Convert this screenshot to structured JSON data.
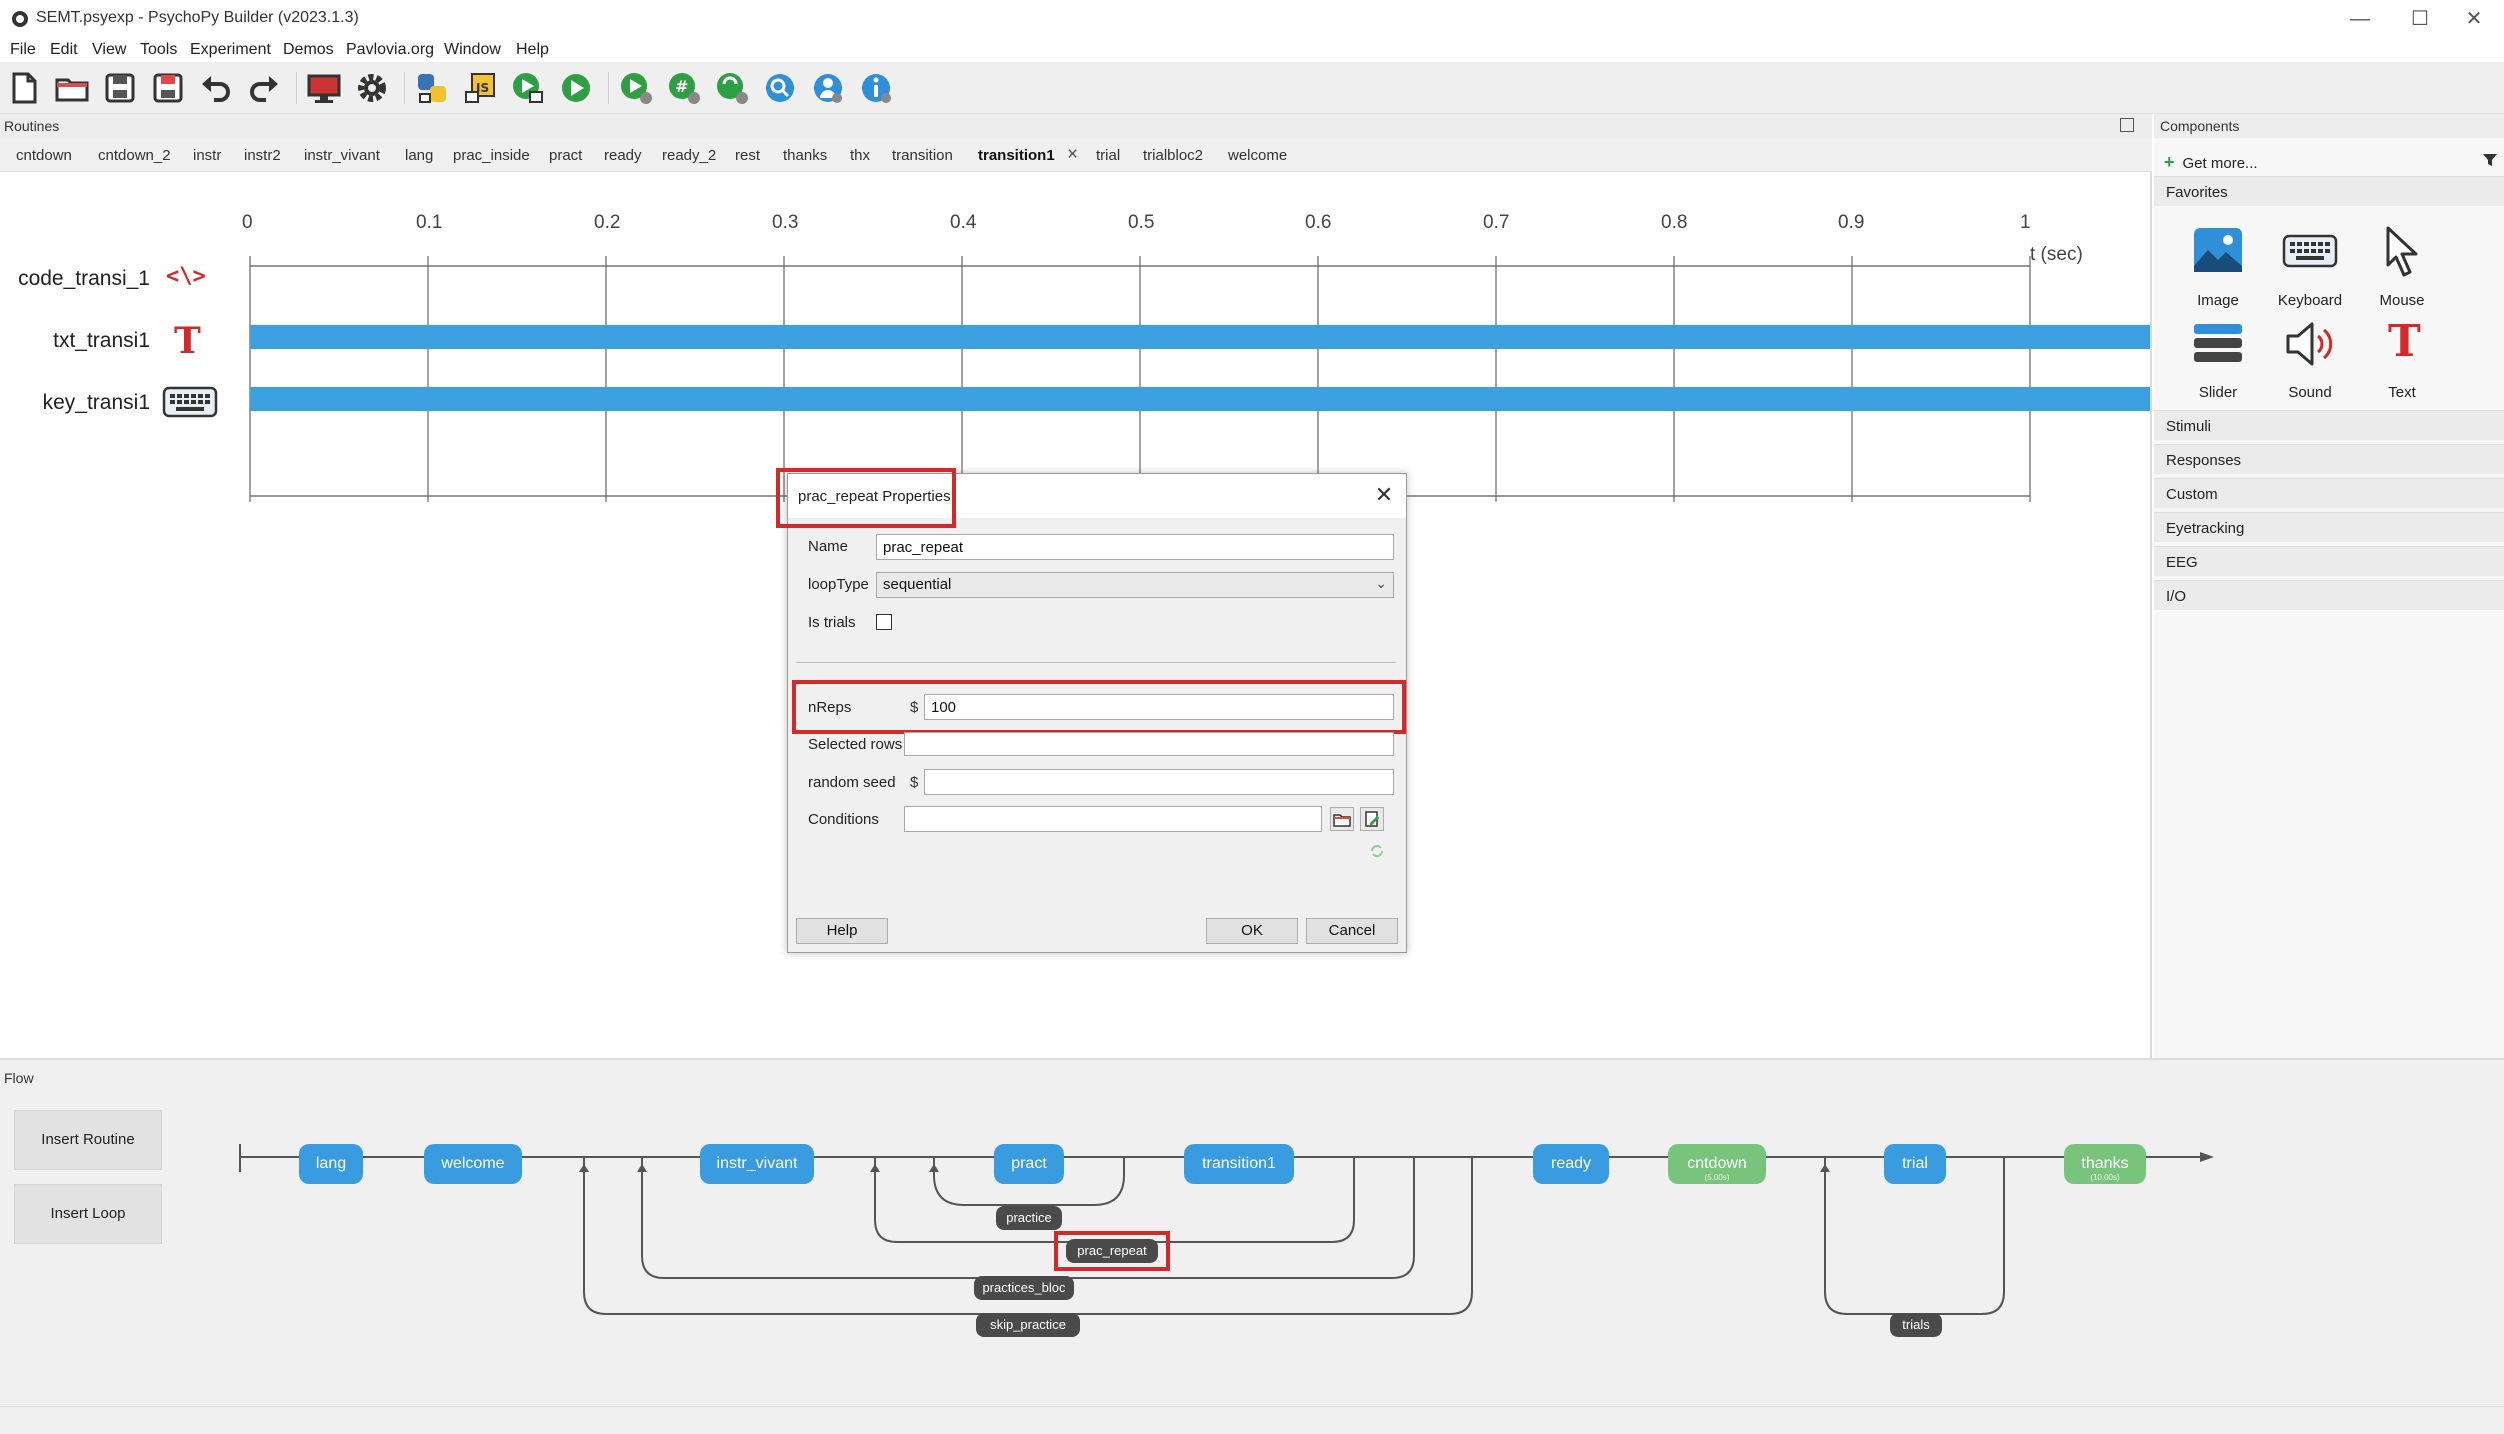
{
  "window": {
    "title": "SEMT.psyexp - PsychoPy Builder (v2023.1.3)",
    "controls": [
      "—",
      "☐",
      "✕"
    ]
  },
  "menu": [
    "File",
    "Edit",
    "View",
    "Tools",
    "Experiment",
    "Demos",
    "Pavlovia.org",
    "Window",
    "Help"
  ],
  "toolbar": {
    "buttons": [
      "new-file-icon",
      "open-folder-icon",
      "save-icon",
      "save-as-icon",
      "undo-icon",
      "redo-icon",
      "monitor-icon",
      "settings-gear-icon",
      "python-icon",
      "js-icon",
      "pilot-run-icon",
      "run-icon",
      "send-to-runner-icon",
      "pavlovia-sync-icon",
      "pavlovia-user-icon",
      "pavlovia-search-icon",
      "pavlovia-project-icon",
      "info-icon"
    ]
  },
  "routines": {
    "header": "Routines",
    "tabs": [
      "cntdown",
      "cntdown_2",
      "instr",
      "instr2",
      "instr_vivant",
      "lang",
      "prac_inside",
      "pract",
      "ready",
      "ready_2",
      "rest",
      "thanks",
      "thx",
      "transition",
      "transition1",
      "trial",
      "trialbloc2",
      "welcome"
    ],
    "active_tab": "transition1",
    "tab_close_glyph": "×",
    "timeline": {
      "ticks": [
        "0",
        "0.1",
        "0.2",
        "0.3",
        "0.4",
        "0.5",
        "0.6",
        "0.7",
        "0.8",
        "0.9",
        "1"
      ],
      "unit_label": "t (sec)",
      "components": [
        {
          "name": "code_transi_1",
          "icon": "code-icon",
          "icon_text": "<\\>",
          "bar": false
        },
        {
          "name": "txt_transi1",
          "icon": "text-icon",
          "icon_text": "T",
          "bar": true
        },
        {
          "name": "key_transi1",
          "icon": "keyboard-icon",
          "icon_text": "",
          "bar": true
        }
      ]
    }
  },
  "dialog": {
    "title": "prac_repeat Properties",
    "close_glyph": "✕",
    "fields": {
      "name_label": "Name",
      "name_value": "prac_repeat",
      "looptype_label": "loopType",
      "looptype_value": "sequential",
      "istrials_label": "Is trials",
      "nreps_label": "nReps",
      "nreps_value": "100",
      "selected_rows_label": "Selected rows",
      "selected_rows_value": "",
      "random_seed_label": "random seed",
      "random_seed_value": "",
      "conditions_label": "Conditions",
      "conditions_value": "",
      "dollar": "$"
    },
    "buttons": {
      "help": "Help",
      "ok": "OK",
      "cancel": "Cancel"
    }
  },
  "components_panel": {
    "header": "Components",
    "get_more": "Get more...",
    "favorites_label": "Favorites",
    "favorites": [
      {
        "label": "Image",
        "icon": "image-icon"
      },
      {
        "label": "Keyboard",
        "icon": "keyboard-icon"
      },
      {
        "label": "Mouse",
        "icon": "mouse-cursor-icon"
      },
      {
        "label": "Slider",
        "icon": "slider-icon"
      },
      {
        "label": "Sound",
        "icon": "sound-icon"
      },
      {
        "label": "Text",
        "icon": "text-icon"
      }
    ],
    "categories": [
      "Stimuli",
      "Responses",
      "Custom",
      "Eyetracking",
      "EEG",
      "I/O"
    ]
  },
  "flow": {
    "header": "Flow",
    "insert_routine": "Insert Routine",
    "insert_loop": "Insert Loop",
    "routines": [
      {
        "label": "lang",
        "color": "#3a9ce0",
        "sub": ""
      },
      {
        "label": "welcome",
        "color": "#3a9ce0",
        "sub": ""
      },
      {
        "label": "instr_vivant",
        "color": "#3a9ce0",
        "sub": ""
      },
      {
        "label": "pract",
        "color": "#3a9ce0",
        "sub": ""
      },
      {
        "label": "transition1",
        "color": "#3a9ce0",
        "sub": ""
      },
      {
        "label": "ready",
        "color": "#3a9ce0",
        "sub": ""
      },
      {
        "label": "cntdown",
        "color": "#79c47c",
        "sub": "(5.00s)"
      },
      {
        "label": "trial",
        "color": "#3a9ce0",
        "sub": ""
      },
      {
        "label": "thanks",
        "color": "#79c47c",
        "sub": "(10.00s)"
      }
    ],
    "loops": [
      "practice",
      "prac_repeat",
      "practices_bloc",
      "skip_practice",
      "trials"
    ]
  },
  "colors": {
    "accent_blue": "#3b9fe0",
    "nonslip_green": "#79c47c",
    "highlight_red": "#d22a2a",
    "loop_label": "#4a4a4a"
  }
}
